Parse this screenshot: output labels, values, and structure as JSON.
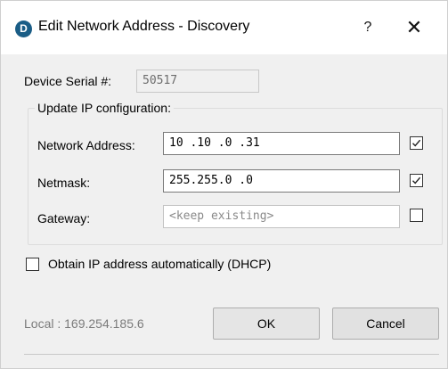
{
  "window": {
    "title": "Edit Network Address - Discovery",
    "app_icon_letter": "D",
    "help_glyph": "?",
    "close_glyph": "✕"
  },
  "device": {
    "serial_label": "Device Serial #:",
    "serial_value": "50517"
  },
  "ip_group": {
    "title": "Update IP configuration:",
    "network_address": {
      "label": "Network Address:",
      "value": "10 .10 .0  .31",
      "checked": true
    },
    "netmask": {
      "label": "Netmask:",
      "value": "255.255.0  .0",
      "checked": true
    },
    "gateway": {
      "label": "Gateway:",
      "placeholder": "<keep existing>",
      "checked": false
    }
  },
  "dhcp": {
    "label": "Obtain IP address automatically (DHCP)",
    "checked": false
  },
  "footer": {
    "local_text": "Local : 169.254.185.6",
    "ok_label": "OK",
    "cancel_label": "Cancel"
  }
}
